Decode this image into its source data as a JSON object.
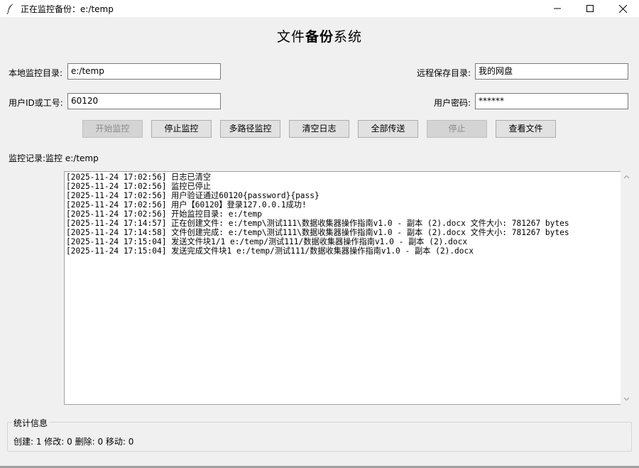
{
  "window": {
    "title": "正在监控备份：e:/temp",
    "minimize_icon": "minimize-icon",
    "maximize_icon": "maximize-icon",
    "close_icon": "close-icon"
  },
  "app": {
    "title_part1": "文件",
    "title_part2": "备份",
    "title_part3": "系统"
  },
  "form": {
    "local_dir_label": "本地监控目录:",
    "local_dir_value": "e:/temp",
    "remote_dir_label": "远程保存目录:",
    "remote_dir_value": "我的网盘",
    "user_id_label": "用户ID或工号:",
    "user_id_value": "60120",
    "password_label": "用户密码:",
    "password_value": "******"
  },
  "toolbar": {
    "start_label": "开始监控",
    "stop_label": "停止监控",
    "multi_label": "多路径监控",
    "clear_label": "清空日志",
    "sendall_label": "全部传送",
    "halt_label": "停止",
    "view_label": "查看文件"
  },
  "monitor": {
    "record_label": "监控记录:",
    "status_text": "监控 e:/temp"
  },
  "log": {
    "lines": [
      "[2025-11-24 17:02:56] 日志已清空",
      "[2025-11-24 17:02:56] 监控已停止",
      "[2025-11-24 17:02:56] 用户验证通过60120{password}{pass}",
      "[2025-11-24 17:02:56] 用户【60120】登录127.0.0.1成功!",
      "[2025-11-24 17:02:56] 开始监控目录: e:/temp",
      "[2025-11-24 17:14:57] 正在创建文件: e:/temp\\测试111\\数据收集器操作指南v1.0 - 副本 (2).docx   文件大小: 781267 bytes",
      "[2025-11-24 17:14:58] 文件创建完成: e:/temp\\测试111\\数据收集器操作指南v1.0 - 副本 (2).docx   文件大小: 781267 bytes",
      "[2025-11-24 17:15:04] 发送文件块1/1  e:/temp/测试111/数据收集器操作指南v1.0 - 副本 (2).docx",
      "[2025-11-24 17:15:04] 发送完成文件块1  e:/temp/测试111/数据收集器操作指南v1.0 - 副本 (2).docx"
    ]
  },
  "stats": {
    "legend": "统计信息",
    "summary": "创建: 1  修改: 0  删除: 0  移动: 0"
  }
}
